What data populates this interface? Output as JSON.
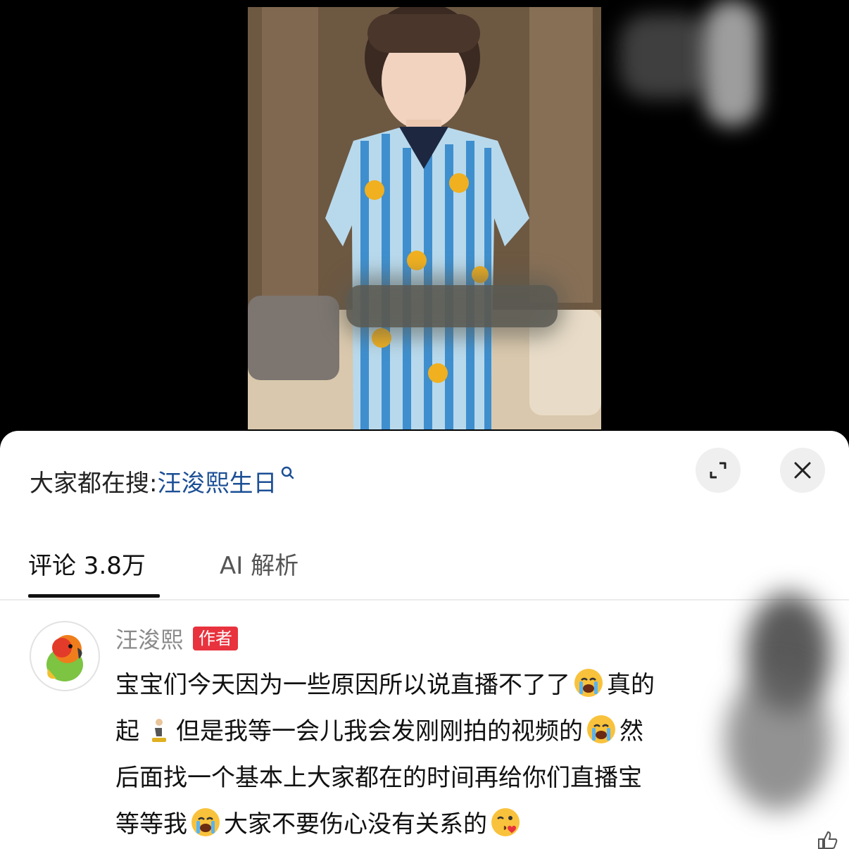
{
  "search": {
    "prefix": "大家都在搜:",
    "term": "汪浚熙生日"
  },
  "tabs": [
    {
      "label": "评论 3.8万",
      "active": true
    },
    {
      "label": "AI 解析",
      "active": false
    }
  ],
  "comment": {
    "username": "汪浚熙",
    "badge": "作者",
    "lines": [
      "宝宝们今天因为一些原因所以说直播不了了",
      "真的",
      "起",
      "但是我等一会儿我会发刚刚拍的视频的",
      "然",
      "后面找一个基本上大家都在的时间再给你们直播宝",
      "等等我",
      "大家不要伤心没有关系的"
    ]
  },
  "colors": {
    "search_term": "#1c4f95",
    "author_badge": "#e8323d",
    "tab_underline": "#111111"
  },
  "icons": {
    "expand": "expand-icon",
    "close": "close-icon",
    "search": "search-icon",
    "emoji_crying": "crying-emoji-icon",
    "emoji_kneeling": "kneeling-person-icon",
    "emoji_kiss": "kissing-heart-emoji-icon",
    "like": "like-icon"
  }
}
